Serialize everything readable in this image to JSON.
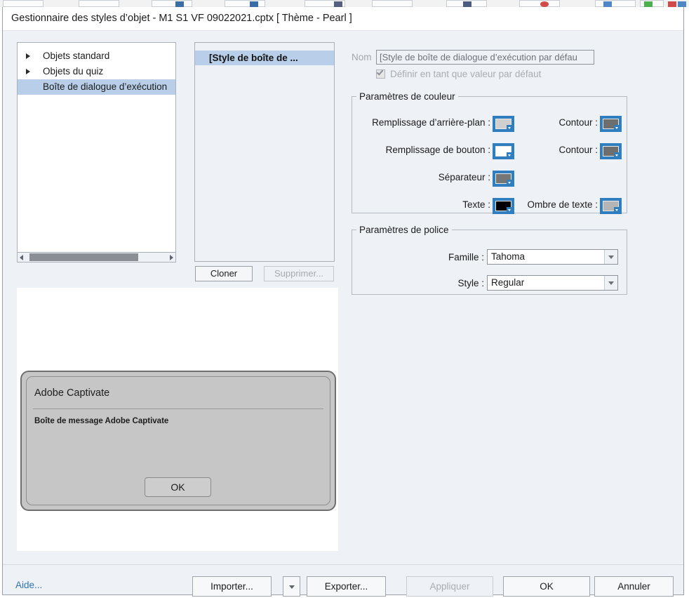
{
  "window": {
    "title": "Gestionnaire des styles d’objet - M1 S1 VF 09022021.cptx [ Thème - Pearl ]"
  },
  "tree": {
    "items": [
      {
        "label": "Objets standard",
        "expandable": true,
        "selected": false
      },
      {
        "label": "Objets du quiz",
        "expandable": true,
        "selected": false
      },
      {
        "label": "Boîte de dialogue d’exécution",
        "expandable": false,
        "selected": true
      }
    ]
  },
  "style_list": {
    "selected_item": "[Style de boîte de ...",
    "clone_label": "Cloner",
    "delete_label": "Supprimer..."
  },
  "name_field": {
    "label": "Nom",
    "value": "[Style de boîte de dialogue d’exécution par défau",
    "checkbox_label": "Définir en tant que valeur par défaut",
    "checkbox_checked": true
  },
  "color_group": {
    "legend": "Paramètres de couleur",
    "rows": [
      {
        "label": "Remplissage d’arrière-plan :",
        "color": "#cfcfcf"
      },
      {
        "label": "Contour :",
        "color": "#6e6e6e"
      },
      {
        "label": "Remplissage de bouton :",
        "color": "#ffffff"
      },
      {
        "label": "Contour :",
        "color": "#6e6e6e"
      },
      {
        "label": "Séparateur :",
        "color": "#767676"
      },
      {
        "label": "Texte :",
        "color": "#000000"
      },
      {
        "label": "Ombre de texte :",
        "color": "#b5b5b5"
      }
    ]
  },
  "font_group": {
    "legend": "Paramètres de police",
    "family_label": "Famille :",
    "family_value": "Tahoma",
    "style_label": "Style :",
    "style_value": "Regular"
  },
  "preview": {
    "dialog_title": "Adobe Captivate",
    "dialog_body": "Boîte de message Adobe Captivate",
    "ok_label": "OK"
  },
  "footer": {
    "help_label": "Aide...",
    "import_label": "Importer...",
    "export_label": "Exporter...",
    "apply_label": "Appliquer",
    "ok_label": "OK",
    "cancel_label": "Annuler"
  },
  "theme": {
    "accent": "#2f7ec0",
    "selection": "#b9cfe9",
    "dialog_bg": "#eef1f5",
    "link": "#2e74b5"
  }
}
